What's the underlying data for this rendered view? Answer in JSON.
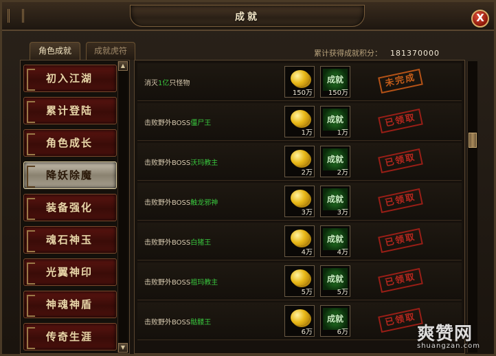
{
  "window": {
    "title": "成就",
    "close_label": "X"
  },
  "tabs": [
    {
      "label": "角色成就",
      "active": true
    },
    {
      "label": "成就虎符",
      "active": false
    }
  ],
  "score": {
    "label": "累计获得成就积分：",
    "value": "181370000"
  },
  "categories": [
    {
      "label": "初入江湖"
    },
    {
      "label": "累计登陆"
    },
    {
      "label": "角色成长"
    },
    {
      "label": "降妖除魔",
      "active": true
    },
    {
      "label": "装备强化"
    },
    {
      "label": "魂石神玉"
    },
    {
      "label": "光翼神印"
    },
    {
      "label": "神魂神盾"
    },
    {
      "label": "传奇生涯"
    }
  ],
  "reward_badge_label": "成就",
  "achievements": [
    {
      "prefix": "消灭",
      "highlight": "1亿",
      "suffix": "只怪物",
      "gold": "150万",
      "points": "150万",
      "status": "未完成",
      "status_kind": "pending"
    },
    {
      "prefix": "击败野外BOSS",
      "highlight": "僵尸王",
      "suffix": "",
      "gold": "1万",
      "points": "1万",
      "status": "已领取",
      "status_kind": "claimed"
    },
    {
      "prefix": "击败野外BOSS",
      "highlight": "沃玛教主",
      "suffix": "",
      "gold": "2万",
      "points": "2万",
      "status": "已领取",
      "status_kind": "claimed"
    },
    {
      "prefix": "击败野外BOSS",
      "highlight": "触龙邪神",
      "suffix": "",
      "gold": "3万",
      "points": "3万",
      "status": "已领取",
      "status_kind": "claimed"
    },
    {
      "prefix": "击败野外BOSS",
      "highlight": "白猪王",
      "suffix": "",
      "gold": "4万",
      "points": "4万",
      "status": "已领取",
      "status_kind": "claimed"
    },
    {
      "prefix": "击败野外BOSS",
      "highlight": "祖玛教主",
      "suffix": "",
      "gold": "5万",
      "points": "5万",
      "status": "已领取",
      "status_kind": "claimed"
    },
    {
      "prefix": "击败野外BOSS",
      "highlight": "骷髅王",
      "suffix": "",
      "gold": "6万",
      "points": "6万",
      "status": "已领取",
      "status_kind": "claimed"
    }
  ],
  "scroll_up": "▲",
  "scroll_down": "▼",
  "watermark": {
    "logo": "爽赞网",
    "url": "shuangzan.com"
  }
}
